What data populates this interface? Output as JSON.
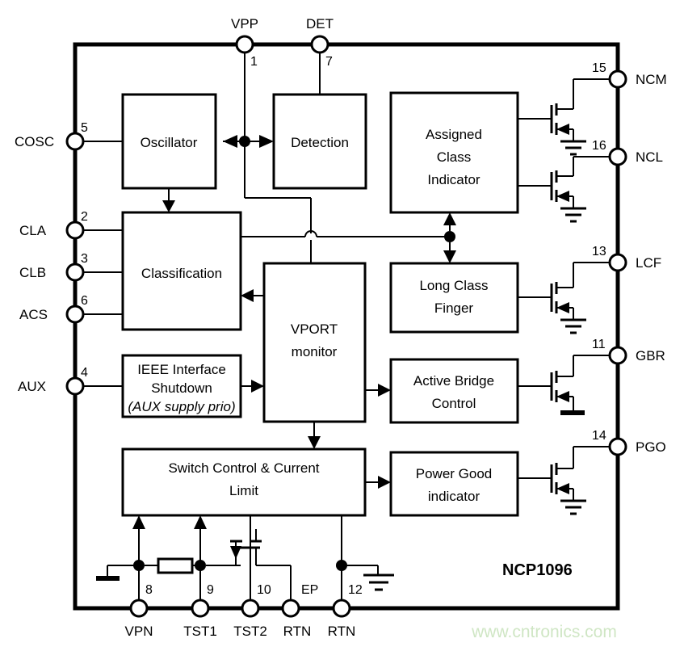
{
  "diagram": {
    "part_number": "NCP1096",
    "watermark": "www.cntronics.com",
    "blocks": [
      {
        "id": "oscillator",
        "lines": [
          "Oscillator"
        ]
      },
      {
        "id": "detection",
        "lines": [
          "Detection"
        ]
      },
      {
        "id": "assigned_class_indicator",
        "lines": [
          "Assigned",
          "Class",
          "Indicator"
        ]
      },
      {
        "id": "classification",
        "lines": [
          "Classification"
        ]
      },
      {
        "id": "long_class_finger",
        "lines": [
          "Long Class",
          "Finger"
        ]
      },
      {
        "id": "ieee_interface_shutdown",
        "lines": [
          "IEEE Interface",
          "Shutdown",
          "(AUX supply prio)"
        ]
      },
      {
        "id": "vport_monitor",
        "lines": [
          "VPORT",
          "monitor"
        ]
      },
      {
        "id": "active_bridge_control",
        "lines": [
          "Active Bridge",
          "Control"
        ]
      },
      {
        "id": "switch_control",
        "lines": [
          "Switch Control & Current",
          "Limit"
        ]
      },
      {
        "id": "power_good_indicator",
        "lines": [
          "Power Good",
          "indicator"
        ]
      }
    ],
    "pins_top": [
      {
        "name": "VPP",
        "num": "1"
      },
      {
        "name": "DET",
        "num": "7"
      }
    ],
    "pins_left": [
      {
        "name": "COSC",
        "num": "5"
      },
      {
        "name": "CLA",
        "num": "2"
      },
      {
        "name": "CLB",
        "num": "3"
      },
      {
        "name": "ACS",
        "num": "6"
      },
      {
        "name": "AUX",
        "num": "4"
      }
    ],
    "pins_right": [
      {
        "name": "NCM",
        "num": "15"
      },
      {
        "name": "NCL",
        "num": "16"
      },
      {
        "name": "LCF",
        "num": "13"
      },
      {
        "name": "GBR",
        "num": "11"
      },
      {
        "name": "PGO",
        "num": "14"
      }
    ],
    "pins_bottom": [
      {
        "name": "VPN",
        "num": "8"
      },
      {
        "name": "TST1",
        "num": "9"
      },
      {
        "name": "TST2",
        "num": "10"
      },
      {
        "name": "RTN",
        "num": "EP"
      },
      {
        "name": "RTN",
        "num": "12"
      }
    ],
    "colors": {
      "ink": "#000000",
      "background": "#ffffff",
      "watermark": "#cfe6c4"
    }
  }
}
